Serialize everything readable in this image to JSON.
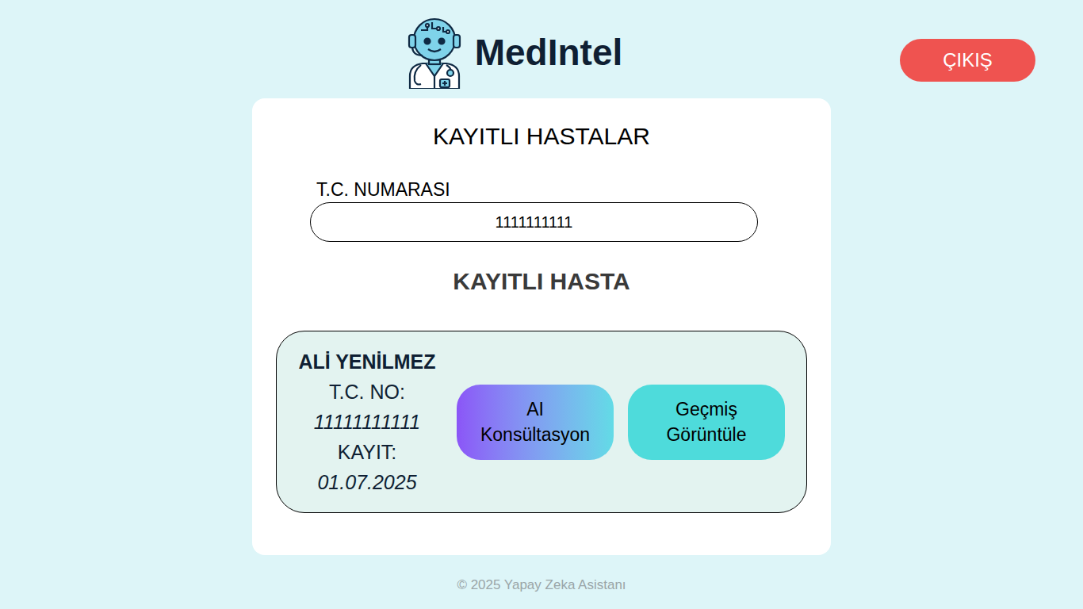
{
  "header": {
    "brand": "MedIntel",
    "logout": "ÇIKIŞ"
  },
  "card": {
    "title": "KAYITLI HASTALAR",
    "field_label": "T.C. NUMARASI",
    "field_value": "1111111111",
    "section_title": "KAYITLI HASTA"
  },
  "patients": [
    {
      "name": "ALİ YENİLMEZ",
      "tc_label": "T.C. NO:",
      "tc": "11111111111",
      "date_label": "KAYIT:",
      "date": "01.07.2025",
      "buttons": [
        {
          "label_lines": [
            "AI",
            "Konsültasyon"
          ],
          "kind": "gradient"
        },
        {
          "label_lines": [
            "Geçmiş",
            "Görüntüle"
          ],
          "kind": "solid"
        }
      ]
    }
  ],
  "footer": "© 2025 Yapay Zeka Asistanı"
}
